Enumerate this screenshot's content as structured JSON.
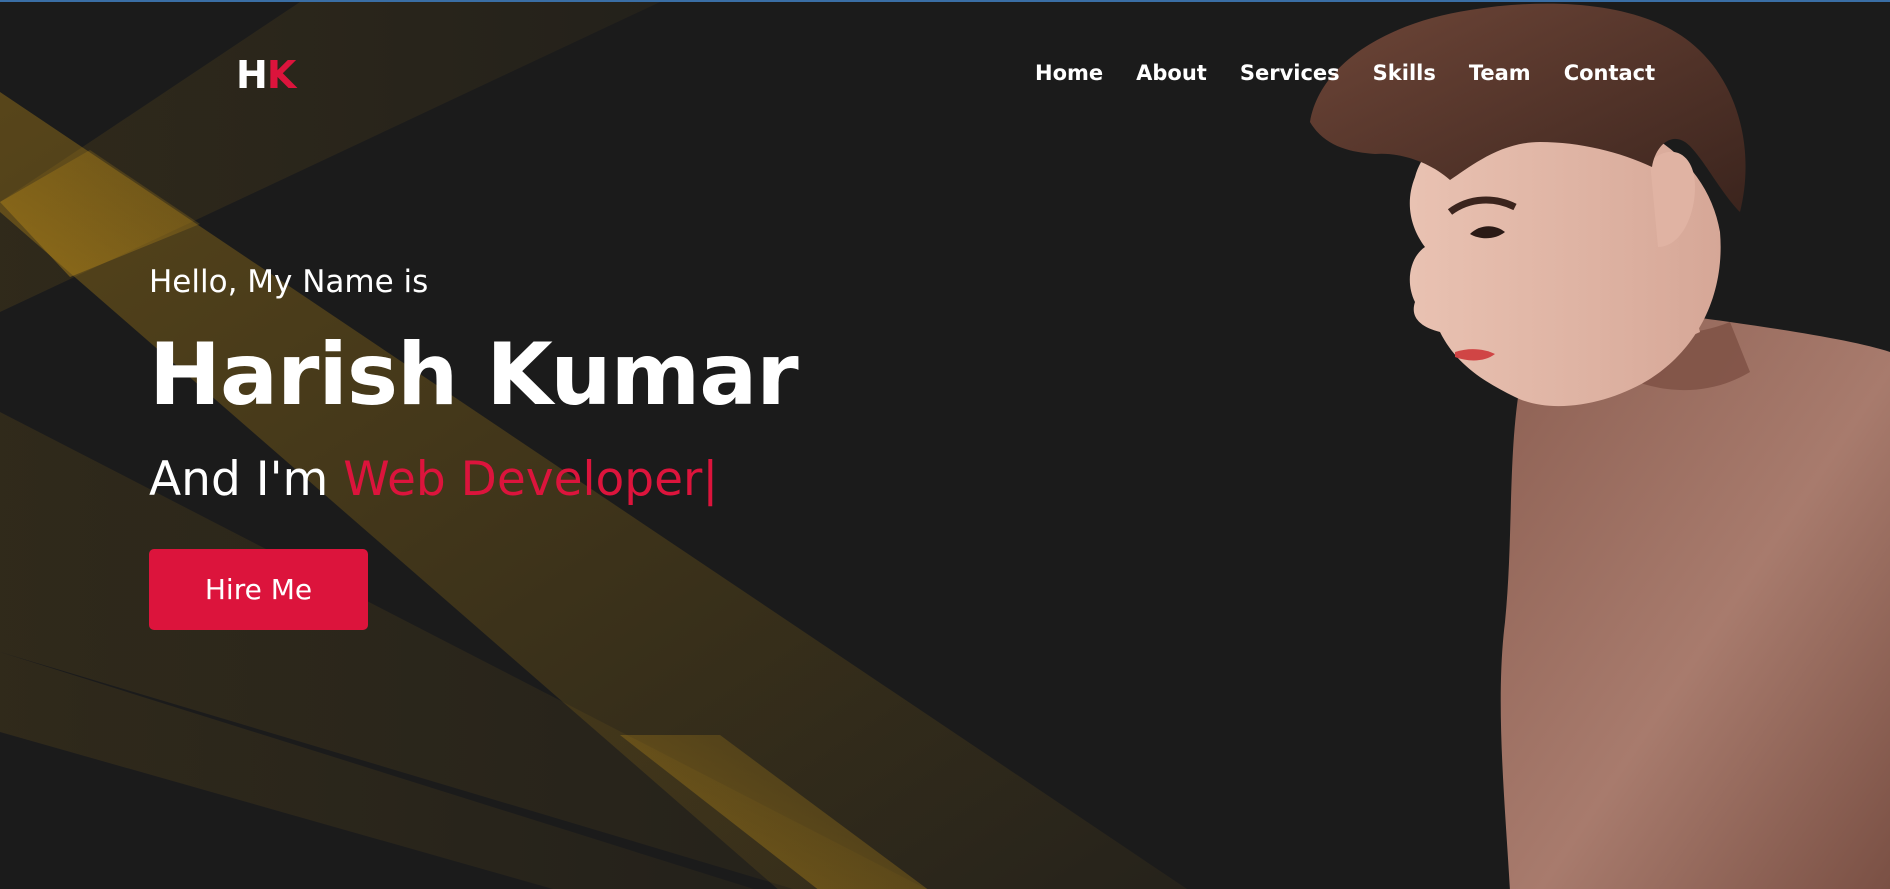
{
  "header": {
    "logo": {
      "part1": "H",
      "part2": "K"
    },
    "nav": [
      {
        "label": "Home"
      },
      {
        "label": "About"
      },
      {
        "label": "Services"
      },
      {
        "label": "Skills"
      },
      {
        "label": "Team"
      },
      {
        "label": "Contact"
      }
    ]
  },
  "hero": {
    "greeting": "Hello, My Name is",
    "name": "Harish Kumar",
    "role_prefix": "And I'm",
    "role_typed": "Web Developer",
    "cursor": "|",
    "cta_label": "Hire Me"
  },
  "colors": {
    "background": "#1b1b1b",
    "accent": "#dc143c",
    "text": "#ffffff",
    "ray": "#c89418"
  }
}
